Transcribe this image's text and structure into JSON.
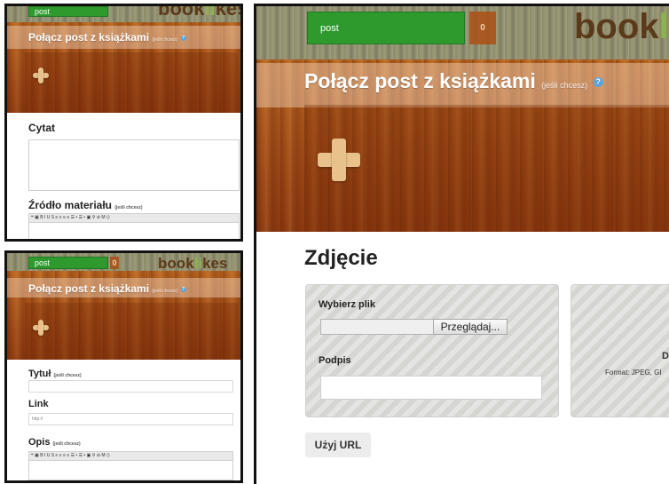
{
  "left_top": {
    "tab_label": "post",
    "logo": "booklikes",
    "title": "Połącz post z książkami",
    "title_optional": "(jeśli chcesz)",
    "help_icon": "question-icon",
    "add_icon": "plus-icon",
    "quote_label": "Cytat",
    "source_label": "Źródło materiału",
    "source_optional": "(jeśli chcesz)",
    "toolbar": "❝ ▣ B I U S ≡ ≡ ≡ ≡ ☰ • ☰ • ▣ ⚲ ⊘ M ⟨⟩"
  },
  "left_bottom": {
    "tab_label": "post",
    "count": "0",
    "logo": "booklikes",
    "title": "Połącz post z książkami",
    "title_optional": "(jeśli chcesz)",
    "title_field_label": "Tytuł",
    "title_field_optional": "(jeśli chcesz)",
    "link_label": "Link",
    "link_placeholder": "http://",
    "desc_label": "Opis",
    "desc_optional": "(jeśli chcesz)",
    "toolbar": "❝ ▣ B I U S ≡ ≡ ≡ ≡ ☰ • ☰ • ▣ ⚲ ⊘ M ⟨⟩"
  },
  "right": {
    "tab_label": "post",
    "count": "0",
    "logo": "bookli",
    "title": "Połącz post z książkami",
    "title_optional": "(jeśli chcesz)",
    "section_title": "Zdjęcie",
    "choose_file_label": "Wybierz plik",
    "browse_button": "Przeglądaj...",
    "caption_label": "Podpis",
    "use_url_button": "Użyj URL",
    "drop_heading": "D",
    "format_text": "Format: JPEG, GI"
  },
  "colors": {
    "green_tab": "#2e9a2e",
    "wood": "#a7521a",
    "help_icon": "#5aa6e0"
  }
}
